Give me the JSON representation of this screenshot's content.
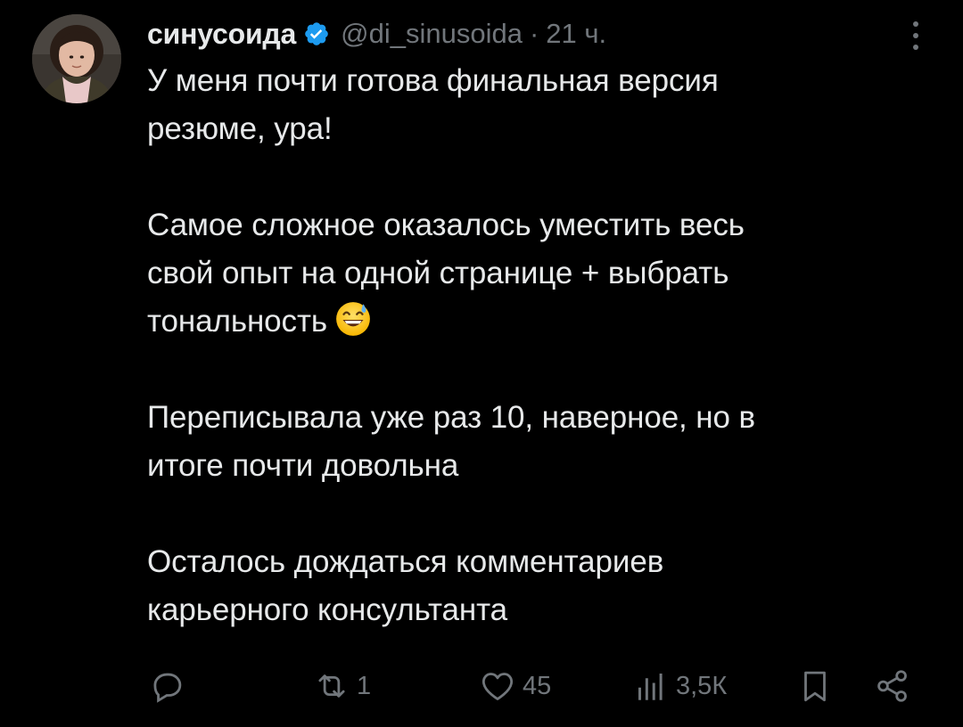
{
  "post": {
    "author": {
      "display_name": "синусоида",
      "handle": "@di_sinusoida",
      "verified": true,
      "avatar_icon": "avatar-photo-icon"
    },
    "separator": "·",
    "time": "21 ч.",
    "paragraphs": [
      [
        "У меня почти готова финальная версия",
        "резюме, ура!"
      ],
      [
        "Самое сложное оказалось уместить весь",
        "свой опыт на одной странице + выбрать",
        "тональность"
      ],
      [
        "Переписывала уже раз 10, наверное, но в",
        "итоге почти довольна"
      ],
      [
        "Осталось дождаться комментариев",
        "карьерного консультанта"
      ]
    ],
    "emoji": "grinning-face-with-sweat-icon",
    "actions": {
      "reply_count": "",
      "repost_count": "1",
      "like_count": "45",
      "views_count": "3,5К"
    }
  },
  "colors": {
    "background": "#000000",
    "text_primary": "#e7e9ea",
    "text_secondary": "#71767b",
    "verified_blue": "#1d9bf0"
  }
}
